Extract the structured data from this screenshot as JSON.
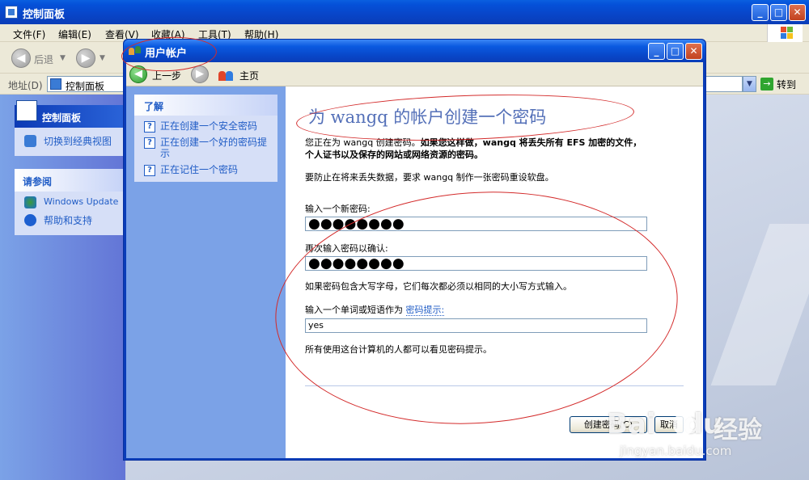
{
  "outer": {
    "title": "控制面板",
    "menus": [
      "文件(F)",
      "编辑(E)",
      "查看(V)",
      "收藏(A)",
      "工具(T)",
      "帮助(H)"
    ],
    "back_label": "后退",
    "address_label": "地址(D)",
    "address_value": "控制面板",
    "go_label": "转到",
    "sidebar": {
      "panel1_title": "控制面板",
      "panel1_item": "切换到经典视图",
      "panel2_title": "请参阅",
      "panel2_items": [
        "Windows Update",
        "帮助和支持"
      ]
    }
  },
  "dialog": {
    "title": "用户帐户",
    "back_label": "上一步",
    "home_label": "主页",
    "learn": {
      "title": "了解",
      "items": [
        "正在创建一个安全密码",
        "正在创建一个好的密码提示",
        "正在记住一个密码"
      ]
    },
    "heading": "为 wangq 的帐户创建一个密码",
    "warning_prefix": "您正在为 wangq 创建密码。",
    "warning_bold": "如果您这样做，wangq 将丢失所有 EFS 加密的文件，个人证书以及保存的网站或网络资源的密码。",
    "reset_disk_note": "要防止在将来丢失数据，要求 wangq 制作一张密码重设软盘。",
    "new_password_label": "输入一个新密码:",
    "new_password_value": "●●●●●●●●",
    "confirm_password_label": "再次输入密码以确认:",
    "confirm_password_value": "●●●●●●●●",
    "case_note": "如果密码包含大写字母，它们每次都必须以相同的大小写方式输入。",
    "hint_label_prefix": "输入一个单词或短语作为",
    "hint_link": "密码提示:",
    "hint_value": "yes",
    "hint_visibility_note": "所有使用这台计算机的人都可以看见密码提示。",
    "create_button": "创建密码(C)",
    "cancel_button": "取消"
  },
  "watermark": {
    "logo": "Bai",
    "logo_tail": "du",
    "cn": "经验",
    "url": "jingyan.baidu.com"
  }
}
